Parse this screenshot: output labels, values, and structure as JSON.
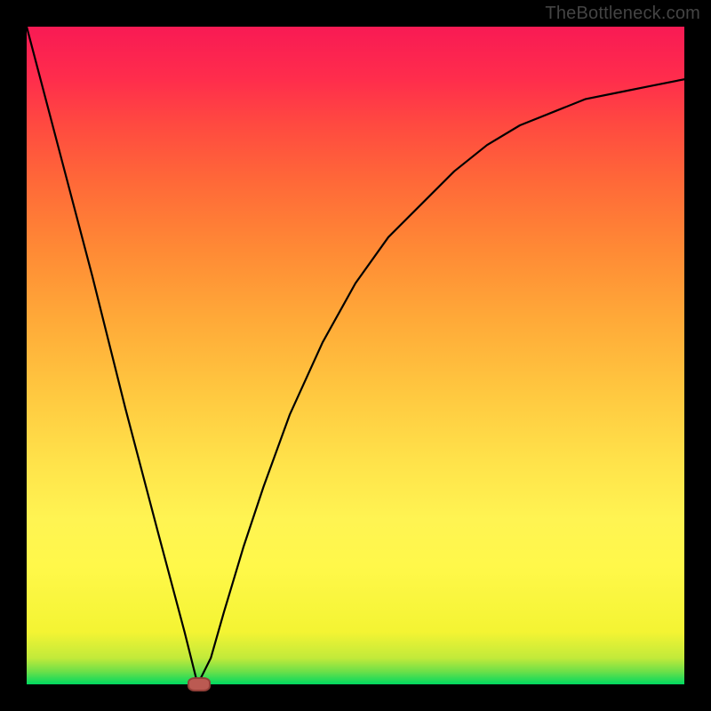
{
  "watermark": "TheBottleneck.com",
  "chart_data": {
    "type": "line",
    "title": "",
    "xlabel": "",
    "ylabel": "",
    "xlim": [
      0,
      100
    ],
    "ylim": [
      0,
      100
    ],
    "grid": false,
    "marker": {
      "x": 26,
      "y": 0
    },
    "series": [
      {
        "name": "curve",
        "x": [
          0,
          5,
          10,
          15,
          20,
          24,
          26,
          28,
          30,
          33,
          36,
          40,
          45,
          50,
          55,
          60,
          65,
          70,
          75,
          80,
          85,
          90,
          95,
          100
        ],
        "values": [
          100,
          81,
          62,
          42,
          23,
          8,
          0,
          4,
          11,
          21,
          30,
          41,
          52,
          61,
          68,
          73,
          78,
          82,
          85,
          87,
          89,
          90,
          91,
          92
        ]
      }
    ]
  }
}
